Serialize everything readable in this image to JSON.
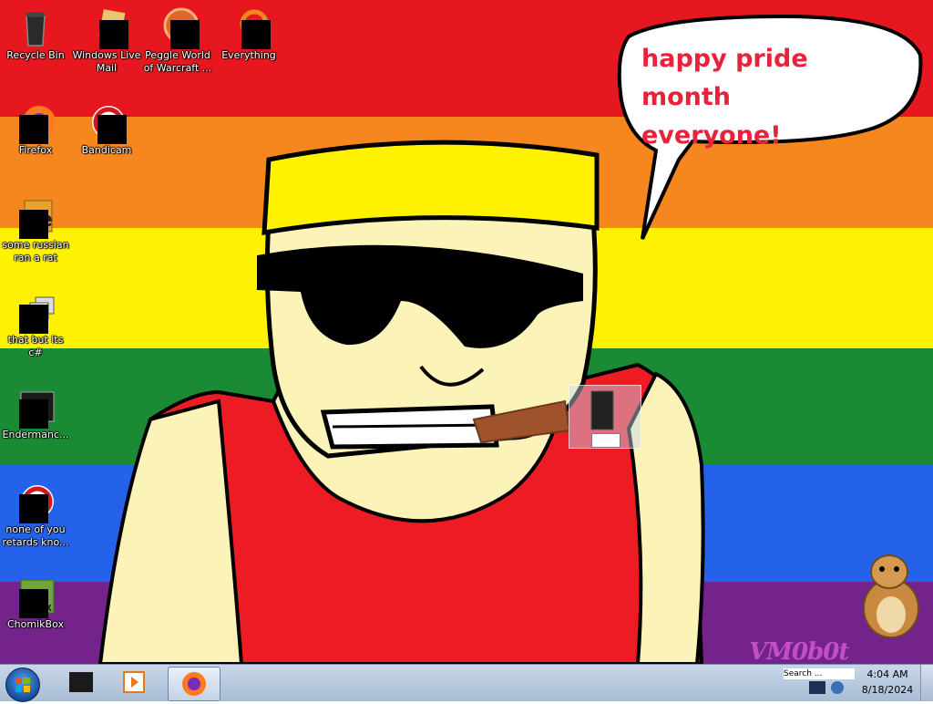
{
  "desktop": {
    "icons": [
      {
        "label": "Recycle Bin"
      },
      {
        "label": "Windows Live Mail"
      },
      {
        "label": "Peggle World of Warcraft ..."
      },
      {
        "label": "Everything"
      },
      {
        "label": "Firefox"
      },
      {
        "label": "Bandicam"
      },
      {
        "label": "some russian ran a rat"
      },
      {
        "label": "that but its c#"
      },
      {
        "label": "Endermanc..."
      },
      {
        "label": "none of you retards kno..."
      },
      {
        "label": "ChomikBox"
      }
    ]
  },
  "wallpaper": {
    "bubble_line1": "happy pride month",
    "bubble_line2": "everyone!",
    "watermark": "VM0b0t",
    "colors": {
      "red": "#e6171f",
      "orange": "#f6871f",
      "yellow": "#fef102",
      "green": "#1a8a35",
      "blue": "#2463e9",
      "purple": "#73238a",
      "skin": "#fcf3b8",
      "shirt": "#ed1c24",
      "text_red": "#e8223a"
    }
  },
  "taskbar": {
    "time": "4:04 AM",
    "date": "8/18/2024",
    "search_placeholder": "Search ..."
  }
}
